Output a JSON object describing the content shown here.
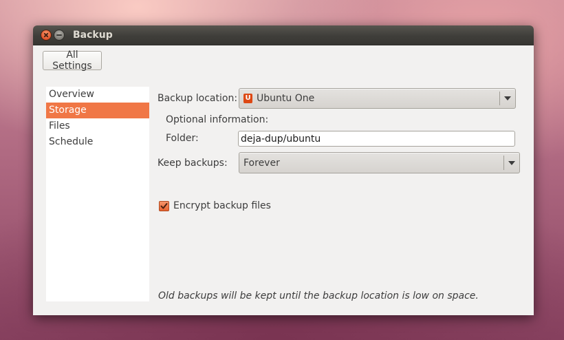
{
  "window": {
    "title": "Backup"
  },
  "toolbar": {
    "all_settings_label": "All Settings"
  },
  "sidebar": {
    "items": [
      {
        "label": "Overview"
      },
      {
        "label": "Storage"
      },
      {
        "label": "Files"
      },
      {
        "label": "Schedule"
      }
    ],
    "selected": "Storage"
  },
  "storage": {
    "backup_location_label": "Backup location:",
    "backup_location_value": "Ubuntu One",
    "backup_location_icon": "ubuntu-one-icon",
    "optional_info_label": "Optional information:",
    "folder_label": "Folder:",
    "folder_value": "deja-dup/ubuntu",
    "keep_backups_label": "Keep backups:",
    "keep_backups_value": "Forever",
    "encrypt_label": "Encrypt backup files",
    "encrypt_checked": true,
    "note": "Old backups will be kept until the backup location is low on space."
  },
  "colors": {
    "accent": "#f07746",
    "titlebar": "#3f3e3a",
    "window_bg": "#f2f1f0"
  }
}
